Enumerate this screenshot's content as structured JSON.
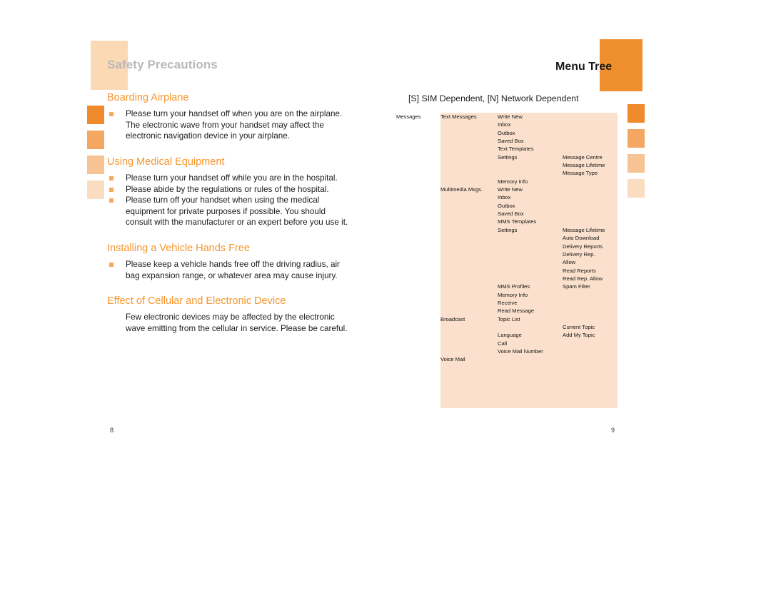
{
  "left_page": {
    "header_title": "Safety Precautions",
    "page_number": "8",
    "sections": [
      {
        "heading": "Boarding Airplane",
        "type": "bullets",
        "items": [
          "Please turn your handset off when you are on the airplane. The electronic wave from your handset may affect the electronic navigation device in your airplane."
        ]
      },
      {
        "heading": "Using Medical Equipment",
        "type": "bullets",
        "items": [
          "Please turn your handset off while you are in the hospital.",
          "Please abide by the regulations or rules of the hospital.",
          "Please turn off your handset when using the medical equipment for private purposes if possible. You should consult with the manufacturer or an expert before you use it."
        ]
      },
      {
        "heading": "Installing a Vehicle Hands Free",
        "type": "bullets",
        "items": [
          "Please keep a vehicle hands free off the driving radius, air bag expansion range, or whatever area may cause injury."
        ]
      },
      {
        "heading": "Effect of Cellular and Electronic Device",
        "type": "plain",
        "items": [
          "Few electronic devices may be affected by the electronic wave emitting from the cellular in service. Please be careful."
        ]
      }
    ]
  },
  "right_page": {
    "header_title": "Menu Tree",
    "page_number": "9",
    "legend": "[S] SIM Dependent, [N] Network Dependent",
    "tree_rows": [
      {
        "c1": "Messages",
        "c2": "Text Messages",
        "c3": "Write New",
        "c4": ""
      },
      {
        "c1": "",
        "c2": "",
        "c3": "Inbox",
        "c4": ""
      },
      {
        "c1": "",
        "c2": "",
        "c3": "Outbox",
        "c4": ""
      },
      {
        "c1": "",
        "c2": "",
        "c3": "Saved Box",
        "c4": ""
      },
      {
        "c1": "",
        "c2": "",
        "c3": "Text Templates",
        "c4": ""
      },
      {
        "c1": "",
        "c2": "",
        "c3": "Settings",
        "c4": "Message Centre"
      },
      {
        "c1": "",
        "c2": "",
        "c3": "",
        "c4": "Message Lifetime"
      },
      {
        "c1": "",
        "c2": "",
        "c3": "",
        "c4": "Message Type"
      },
      {
        "c1": "",
        "c2": "",
        "c3": "Memory Info",
        "c4": ""
      },
      {
        "c1": "",
        "c2": "Multimedia Msgs.",
        "c3": "Write New",
        "c4": ""
      },
      {
        "c1": "",
        "c2": "",
        "c3": "Inbox",
        "c4": ""
      },
      {
        "c1": "",
        "c2": "",
        "c3": "Outbox",
        "c4": ""
      },
      {
        "c1": "",
        "c2": "",
        "c3": "Saved Box",
        "c4": ""
      },
      {
        "c1": "",
        "c2": "",
        "c3": "MMS Templates",
        "c4": ""
      },
      {
        "c1": "",
        "c2": "",
        "c3": "Settings",
        "c4": "Message Lifetime"
      },
      {
        "c1": "",
        "c2": "",
        "c3": "",
        "c4": "Auto Download"
      },
      {
        "c1": "",
        "c2": "",
        "c3": "",
        "c4": "Delivery Reports"
      },
      {
        "c1": "",
        "c2": "",
        "c3": "",
        "c4": "Delivery Rep."
      },
      {
        "c1": "",
        "c2": "",
        "c3": "",
        "c4": "Allow"
      },
      {
        "c1": "",
        "c2": "",
        "c3": "",
        "c4": "Read Reports"
      },
      {
        "c1": "",
        "c2": "",
        "c3": "",
        "c4": "Read Rep. Allow"
      },
      {
        "c1": "",
        "c2": "",
        "c3": "MMS Profiles",
        "c4": "Spam Filter"
      },
      {
        "c1": "",
        "c2": "",
        "c3": "Memory Info",
        "c4": ""
      },
      {
        "c1": "",
        "c2": "",
        "c3": "Receive",
        "c4": ""
      },
      {
        "c1": "",
        "c2": "",
        "c3": "Read Message",
        "c4": ""
      },
      {
        "c1": "",
        "c2": "Broadcast",
        "c3": "Topic List",
        "c4": ""
      },
      {
        "c1": "",
        "c2": "",
        "c3": "",
        "c4": "Current Topic"
      },
      {
        "c1": "",
        "c2": "",
        "c3": "Language",
        "c4": "Add My Topic"
      },
      {
        "c1": "",
        "c2": "",
        "c3": "Call",
        "c4": ""
      },
      {
        "c1": "",
        "c2": "",
        "c3": "Voice Mail Number",
        "c4": ""
      },
      {
        "c1": "",
        "c2": "Voice Mail",
        "c3": "",
        "c4": ""
      }
    ]
  },
  "decor": {
    "square_colors": [
      "#ef8b2c",
      "#f3a761",
      "#f7c294",
      "#fadcc0"
    ]
  }
}
